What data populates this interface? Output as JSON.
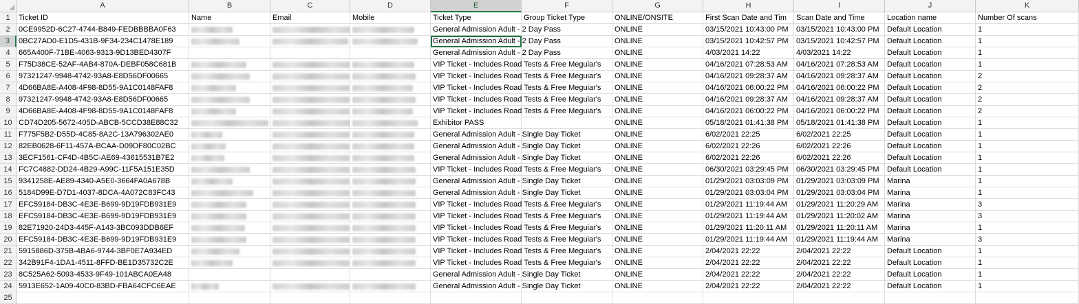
{
  "columns": [
    "A",
    "B",
    "C",
    "D",
    "E",
    "F",
    "G",
    "H",
    "I",
    "J",
    "K"
  ],
  "selected_column": "E",
  "selected_row": "3",
  "rows": [
    {
      "n": "1",
      "a": "Ticket ID",
      "b": "Name",
      "c": "Email",
      "d": "Mobile",
      "e": "Ticket Type",
      "f": "Group Ticket Type",
      "g": "ONLINE/ONSITE",
      "h": "First Scan Date and Tim",
      "i": "Scan Date and Time",
      "j": "Location name",
      "k": "Number Of scans",
      "header": true
    },
    {
      "n": "2",
      "a": "0CE9952D-6C27-4744-B849-FEDBBBBA0F63",
      "e": "General Admission Adult - 2 Day Pass",
      "g": "ONLINE",
      "h": "03/15/2021 10:43:00 PM",
      "i": "03/15/2021 10:43:00 PM",
      "j": "Default Location",
      "k": "1",
      "blur": [
        60,
        120,
        90
      ]
    },
    {
      "n": "3",
      "a": "0BC27AD0-E1D5-431B-9F34-234C1478E189",
      "e": "General Admission Adult - 2 Day Pass",
      "g": "ONLINE",
      "h": "03/15/2021 10:42:57 PM",
      "i": "03/15/2021 10:42:57 PM",
      "j": "Default Location",
      "k": "1",
      "blur": [
        70,
        110,
        95
      ]
    },
    {
      "n": "4",
      "a": "665A400F-71BE-4063-9313-9D13BED4307F",
      "e": "General Admission Adult - 2 Day Pass",
      "g": "ONLINE",
      "h": "4/03/2021 14:22",
      "i": "4/03/2021 14:22",
      "j": "Default Location",
      "k": "1",
      "blur": [
        0,
        0,
        0
      ]
    },
    {
      "n": "5",
      "a": "F75D38CE-52AF-4AB4-870A-DEBF058C681B",
      "e": "VIP Ticket - Includes Road Tests & Free Meguiar's",
      "g": "ONLINE",
      "h": "04/16/2021 07:28:53 AM",
      "i": "04/16/2021 07:28:53 AM",
      "j": "Default Location",
      "k": "1",
      "blur": [
        80,
        115,
        90
      ]
    },
    {
      "n": "6",
      "a": "97321247-9948-4742-93A8-E8D56DF00665",
      "e": "VIP Ticket - Includes Road Tests & Free Meguiar's",
      "g": "ONLINE",
      "h": "04/16/2021 09:28:37 AM",
      "i": "04/16/2021 09:28:37 AM",
      "j": "Default Location",
      "k": "2",
      "blur": [
        85,
        112,
        92
      ]
    },
    {
      "n": "7",
      "a": "4D66BA8E-A408-4F98-8D55-9A1C0148FAF8",
      "e": "VIP Ticket - Includes Road Tests & Free Meguiar's",
      "g": "ONLINE",
      "h": "04/16/2021 06:00:22 PM",
      "i": "04/16/2021 06:00:22 PM",
      "j": "Default Location",
      "k": "2",
      "blur": [
        65,
        112,
        88
      ]
    },
    {
      "n": "8",
      "a": "97321247-9948-4742-93A8-E8D56DF00665",
      "e": "VIP Ticket - Includes Road Tests & Free Meguiar's",
      "g": "ONLINE",
      "h": "04/16/2021 09:28:37 AM",
      "i": "04/16/2021 09:28:37 AM",
      "j": "Default Location",
      "k": "2",
      "blur": [
        85,
        112,
        92
      ]
    },
    {
      "n": "9",
      "a": "4D66BA8E-A408-4F98-8D55-9A1C0148FAF8",
      "e": "VIP Ticket - Includes Road Tests & Free Meguiar's",
      "g": "ONLINE",
      "h": "04/16/2021 06:00:22 PM",
      "i": "04/16/2021 06:00:22 PM",
      "j": "Default Location",
      "k": "2",
      "blur": [
        65,
        112,
        88
      ]
    },
    {
      "n": "10",
      "a": "CD74D205-5672-405D-ABCB-5CCD38E88C32",
      "e": "Exhibitor PASS",
      "g": "ONLINE",
      "h": "05/18/2021 01:41:38 PM",
      "i": "05/18/2021 01:41:38 PM",
      "j": "Default Location",
      "k": "1",
      "blur": [
        112,
        115,
        95
      ]
    },
    {
      "n": "11",
      "a": "F775F5B2-D55D-4C85-8A2C-13A796302AE0",
      "e": "General Admission Adult - Single Day Ticket",
      "g": "ONLINE",
      "h": "6/02/2021 22:25",
      "i": "6/02/2021 22:25",
      "j": "Default Location",
      "k": "1",
      "blur": [
        45,
        112,
        90
      ]
    },
    {
      "n": "12",
      "a": "82EB0628-6F11-457A-BCAA-D09DF80C02BC",
      "e": "General Admission Adult - Single Day Ticket",
      "g": "ONLINE",
      "h": "6/02/2021 22:26",
      "i": "6/02/2021 22:26",
      "j": "Default Location",
      "k": "1",
      "blur": [
        50,
        112,
        90
      ]
    },
    {
      "n": "13",
      "a": "3ECF1561-CF4D-4B5C-AE69-43615531B7E2",
      "e": "General Admission Adult - Single Day Ticket",
      "g": "ONLINE",
      "h": "6/02/2021 22:26",
      "i": "6/02/2021 22:26",
      "j": "Default Location",
      "k": "1",
      "blur": [
        48,
        112,
        90
      ]
    },
    {
      "n": "14",
      "a": "FC7C4882-DD24-4B29-A99C-11F5A151E35D",
      "e": "VIP Ticket - Includes Road Tests & Free Meguiar's",
      "g": "ONLINE",
      "h": "06/30/2021 03:29:45 PM",
      "i": "06/30/2021 03:29:45 PM",
      "j": "Default Location",
      "k": "1",
      "blur": [
        85,
        112,
        92
      ]
    },
    {
      "n": "15",
      "a": "9341258E-AE89-4340-A5E0-3664FA0A678B",
      "e": "General Admission Adult - Single Day Ticket",
      "g": "ONLINE",
      "h": "01/29/2021 03:03:09 PM",
      "i": "01/29/2021 03:03:09 PM",
      "j": "Marina",
      "k": "1",
      "blur": [
        60,
        112,
        92
      ]
    },
    {
      "n": "16",
      "a": "5184D99E-D7D1-4037-8DCA-4A072C83FC43",
      "e": "General Admission Adult - Single Day Ticket",
      "g": "ONLINE",
      "h": "01/29/2021 03:03:04 PM",
      "i": "01/29/2021 03:03:04 PM",
      "j": "Marina",
      "k": "1",
      "blur": [
        90,
        112,
        92
      ]
    },
    {
      "n": "17",
      "a": "EFC59184-DB3C-4E3E-B699-9D19FDB931E9",
      "e": "VIP Ticket - Includes Road Tests & Free Meguiar's",
      "g": "ONLINE",
      "h": "01/29/2021 11:19:44 AM",
      "i": "01/29/2021 11:20:29 AM",
      "j": "Marina",
      "k": "3",
      "blur": [
        80,
        112,
        92
      ]
    },
    {
      "n": "18",
      "a": "EFC59184-DB3C-4E3E-B699-9D19FDB931E9",
      "e": "VIP Ticket - Includes Road Tests & Free Meguiar's",
      "g": "ONLINE",
      "h": "01/29/2021 11:19:44 AM",
      "i": "01/29/2021 11:20:02 AM",
      "j": "Marina",
      "k": "3",
      "blur": [
        80,
        112,
        92
      ]
    },
    {
      "n": "19",
      "a": "82E71920-24D3-445F-A143-3BC093DDB6EF",
      "e": "VIP Ticket - Includes Road Tests & Free Meguiar's",
      "g": "ONLINE",
      "h": "01/29/2021 11:20:11 AM",
      "i": "01/29/2021 11:20:11 AM",
      "j": "Marina",
      "k": "1",
      "blur": [
        78,
        112,
        92
      ]
    },
    {
      "n": "20",
      "a": "EFC59184-DB3C-4E3E-B699-9D19FDB931E9",
      "e": "VIP Ticket - Includes Road Tests & Free Meguiar's",
      "g": "ONLINE",
      "h": "01/29/2021 11:19:44 AM",
      "i": "01/29/2021 11:19:44 AM",
      "j": "Marina",
      "k": "3",
      "blur": [
        80,
        112,
        92
      ]
    },
    {
      "n": "21",
      "a": "5915886D-375B-4BA6-9744-3BF0E7A934ED",
      "e": "VIP Ticket - Includes Road Tests & Free Meguiar's",
      "g": "ONLINE",
      "h": "2/04/2021 22:22",
      "i": "2/04/2021 22:22",
      "j": "Default Location",
      "k": "1",
      "blur": [
        70,
        112,
        92
      ]
    },
    {
      "n": "22",
      "a": "342B91F4-1DA1-4511-8FFD-BE1D35732C2E",
      "e": "VIP Ticket - Includes Road Tests & Free Meguiar's",
      "g": "ONLINE",
      "h": "2/04/2021 22:22",
      "i": "2/04/2021 22:22",
      "j": "Default Location",
      "k": "1",
      "blur": [
        60,
        112,
        92
      ]
    },
    {
      "n": "23",
      "a": "8C525A62-5093-4533-9F49-101ABCA0EA48",
      "e": "General Admission Adult - Single Day Ticket",
      "g": "ONLINE",
      "h": "2/04/2021 22:22",
      "i": "2/04/2021 22:22",
      "j": "Default Location",
      "k": "1",
      "blur": [
        0,
        0,
        0
      ]
    },
    {
      "n": "24",
      "a": "5913E652-1A09-40C0-83BD-FBA64CFC6EAE",
      "e": "General Admission Adult - Single Day Ticket",
      "g": "ONLINE",
      "h": "2/04/2021 22:22",
      "i": "2/04/2021 22:22",
      "j": "Default Location",
      "k": "1",
      "blur": [
        40,
        112,
        92
      ]
    },
    {
      "n": "25",
      "partial": true
    }
  ]
}
